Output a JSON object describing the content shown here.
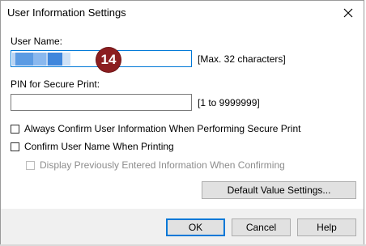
{
  "window": {
    "title": "User Information Settings",
    "close_icon": "close-icon"
  },
  "user_name": {
    "label": "User Name:",
    "value": "",
    "hint": "[Max. 32 characters]",
    "badge": "14"
  },
  "pin": {
    "label": "PIN for Secure Print:",
    "value": "",
    "hint": "[1 to 9999999]"
  },
  "options": {
    "always_confirm": {
      "label": "Always Confirm User Information When Performing Secure Print",
      "checked": false
    },
    "confirm_user_name": {
      "label": "Confirm User Name When Printing",
      "checked": false
    },
    "display_previous": {
      "label": "Display Previously Entered Information When Confirming",
      "checked": false,
      "enabled": false
    }
  },
  "buttons": {
    "default_value_settings": "Default Value Settings...",
    "ok": "OK",
    "cancel": "Cancel",
    "help": "Help"
  },
  "colors": {
    "focus_border": "#0078d7",
    "badge_bg": "#8b1e20",
    "redaction": "#4a90e2"
  }
}
